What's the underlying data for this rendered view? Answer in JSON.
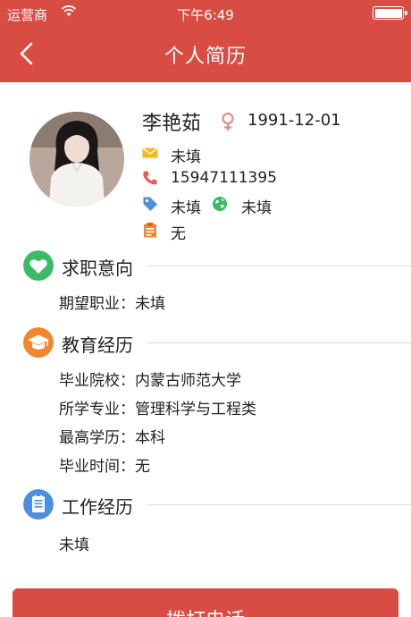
{
  "status_bar": {
    "carrier": "运营商",
    "time": "下午6:49"
  },
  "nav": {
    "title": "个人简历"
  },
  "profile": {
    "name": "李艳茹",
    "birthday": "1991-12-01",
    "email": "未填",
    "phone": "15947111395",
    "tag": "未填",
    "region": "未填",
    "note": "无"
  },
  "sections": {
    "intent": {
      "title": "求职意向",
      "items": [
        {
          "label": "期望职业：",
          "value": "未填"
        }
      ]
    },
    "education": {
      "title": "教育经历",
      "items": [
        {
          "label": "毕业院校：",
          "value": "内蒙古师范大学"
        },
        {
          "label": "所学专业：",
          "value": "管理科学与工程类"
        },
        {
          "label": "最高学历：",
          "value": "本科"
        },
        {
          "label": "毕业时间：",
          "value": "无"
        }
      ]
    },
    "work": {
      "title": "工作经历",
      "content": "未填"
    }
  },
  "call_button": {
    "label": "拨打电话"
  },
  "colors": {
    "brand": "#d94c43",
    "intent_icon": "#3cba67",
    "education_icon": "#f0872d",
    "work_icon": "#4e8ee0"
  }
}
